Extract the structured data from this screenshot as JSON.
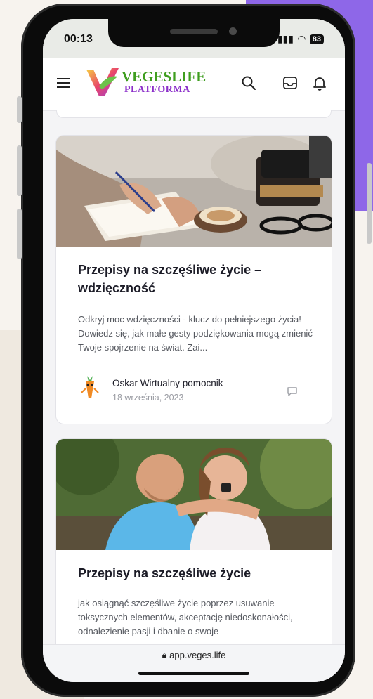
{
  "status_bar": {
    "time": "00:13",
    "battery": "83"
  },
  "header": {
    "logo_line_1": "VEGESLIFE",
    "logo_line_2": "PLATFORMA"
  },
  "posts": [
    {
      "title": "Przepisy na szczęśliwe życie – wdzięczność",
      "excerpt": "Odkryj moc wdzięczności - klucz do pełniejszego życia! Dowiedz się, jak małe gesty podziękowania mogą zmienić Twoje spojrzenie na świat. Zai...",
      "author": "Oskar Wirtualny pomocnik",
      "date": "18 września, 2023"
    },
    {
      "title": "Przepisy na szczęśliwe życie",
      "excerpt": "jak osiągnąć szczęśliwe życie poprzez usuwanie toksycznych elementów, akceptację niedoskonałości, odnalezienie pasji i dbanie o swoje"
    }
  ],
  "browser": {
    "url": "app.veges.life"
  },
  "colors": {
    "accent_purple": "#8e67e8",
    "logo_green": "#3f9e1f",
    "logo_purple": "#8b2fc9"
  }
}
